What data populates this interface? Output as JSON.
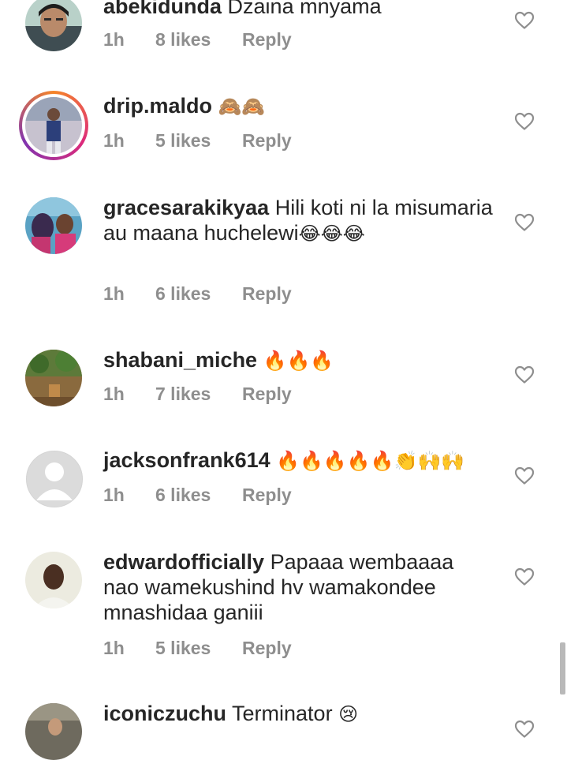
{
  "comments": [
    {
      "username": "abekidunda",
      "text": "Dzaina mnyama",
      "emoji": "",
      "time": "1h",
      "likes": "8 likes",
      "reply": "Reply"
    },
    {
      "username": "drip.maldo",
      "text": "",
      "emoji": "🙈🙈",
      "time": "1h",
      "likes": "5 likes",
      "reply": "Reply"
    },
    {
      "username": "gracesarakikyaa",
      "text": "Hili koti ni la misumaria au maana huchelewi",
      "emoji": "😂😂😂",
      "time": "1h",
      "likes": "6 likes",
      "reply": "Reply"
    },
    {
      "username": "shabani_miche",
      "text": "",
      "emoji": "🔥🔥🔥",
      "time": "1h",
      "likes": "7 likes",
      "reply": "Reply"
    },
    {
      "username": "jacksonfrank614",
      "text": "",
      "emoji": "🔥🔥🔥🔥🔥👏🙌🙌",
      "time": "1h",
      "likes": "6 likes",
      "reply": "Reply"
    },
    {
      "username": "edwardofficially",
      "text": "Papaaa wembaaaa nao wamekushind hv wamakondee mnashidaa ganiii",
      "emoji": "",
      "time": "1h",
      "likes": "5 likes",
      "reply": "Reply"
    },
    {
      "username": "iconiczuchu",
      "text": "Terminator",
      "emoji": "😢",
      "time": "",
      "likes": "",
      "reply": ""
    }
  ],
  "colors": {
    "text": "#262626",
    "meta": "#8e8e8e",
    "heart_outline": "#8e8e8e"
  },
  "icons": {
    "like": "heart-outline-icon",
    "avatar_placeholder": "default-avatar-icon"
  }
}
